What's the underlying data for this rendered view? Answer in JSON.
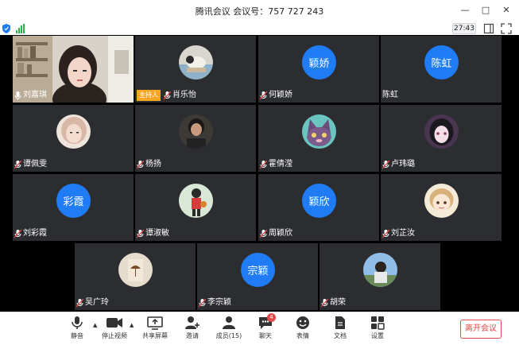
{
  "window": {
    "title": "腾讯会议 会议号：757 727 243"
  },
  "window_controls": [
    "—",
    "□",
    "✕"
  ],
  "timer": "27:43",
  "colors": {
    "accent_blue": "#1f7cf5",
    "host_badge": "#f5a623",
    "leave_red": "#e24a4a",
    "tile_bg": "#2b2d30",
    "signal_green": "#2fb24d"
  },
  "participants": [
    {
      "name": "刘嘉琪",
      "avatar": "photo-video-feed",
      "video_on": true
    },
    {
      "name": "肖乐怡",
      "avatar": "photo-sleeping-figure",
      "host": true,
      "host_label": "主持人"
    },
    {
      "name": "何颖娇",
      "avatar_text": "颖娇"
    },
    {
      "name": "陈虹",
      "avatar_text": "陈虹",
      "no_mic_icon": true
    },
    {
      "name": "谭佩雯",
      "avatar": "photo-face"
    },
    {
      "name": "杨扬",
      "avatar": "photo-person-dark"
    },
    {
      "name": "霍倩滢",
      "avatar": "photo-cartoon-cat"
    },
    {
      "name": "卢玮璐",
      "avatar": "photo-anime"
    },
    {
      "name": "刘彩霞",
      "avatar_text": "彩霞"
    },
    {
      "name": "谭淑敏",
      "avatar": "photo-basketball"
    },
    {
      "name": "周颖欣",
      "avatar_text": "颖欣"
    },
    {
      "name": "刘芷汝",
      "avatar": "photo-cartoon-girl"
    },
    {
      "name": "吴广玲",
      "avatar": "photo-umbrella-figure"
    },
    {
      "name": "李宗颖",
      "avatar_text": "宗颖"
    },
    {
      "name": "胡荣",
      "avatar": "photo-outdoor"
    }
  ],
  "toolbar": {
    "mute": "静音",
    "stop_video": "停止视频",
    "share_screen": "共享屏幕",
    "invite": "邀请",
    "members": "成员(15)",
    "chat": "聊天",
    "chat_badge": "4",
    "reactions": "表情",
    "documents": "文档",
    "settings": "设置",
    "leave": "离开会议"
  }
}
